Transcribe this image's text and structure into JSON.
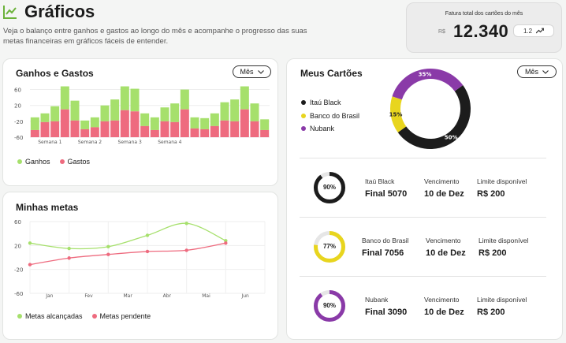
{
  "page": {
    "title": "Gráficos",
    "description": "Veja o balanço entre ganhos e gastos ao longo do mês e acompanhe o progresso das suas metas financeiras em gráficos fáceis de entender."
  },
  "fatura": {
    "label": "Fatura total dos cartões do mês",
    "currency": "R$",
    "value": "12.340",
    "trend": "1.2",
    "trend_icon": "trend-up-icon"
  },
  "ganhos_gastos": {
    "title": "Ganhos e Gastos",
    "filter": "Mês",
    "legend": [
      "Ganhos",
      "Gastos"
    ]
  },
  "metas": {
    "title": "Minhas metas",
    "legend": [
      "Metas alcançadas",
      "Metas pendente"
    ]
  },
  "cartoes": {
    "title": "Meus Cartões",
    "filter": "Mês",
    "legend": [
      "Itaú Black",
      "Banco do Brasil",
      "Nubank"
    ],
    "cards": [
      {
        "pct_label": "90%",
        "pct": 90,
        "color": "#1c1c1c",
        "name": "Itaú Black",
        "final": "Final 5070",
        "venc_label": "Vencimento",
        "venc": "10 de Dez",
        "limite_label": "Limite disponível",
        "limite": "R$ 200"
      },
      {
        "pct_label": "77%",
        "pct": 77,
        "color": "#e8d51e",
        "name": "Banco do Brasil",
        "final": "Final 7056",
        "venc_label": "Vencimento",
        "venc": "10 de Dez",
        "limite_label": "Limite disponível",
        "limite": "R$ 200"
      },
      {
        "pct_label": "90%",
        "pct": 90,
        "color": "#8a3aa8",
        "name": "Nubank",
        "final": "Final 3090",
        "venc_label": "Vencimento",
        "venc": "10 de Dez",
        "limite_label": "Limite disponível",
        "limite": "R$ 200"
      }
    ]
  },
  "colors": {
    "accent_green": "#a6e06c",
    "accent_red": "#ee6b7f",
    "donut_black": "#1c1c1c",
    "donut_yellow": "#e8d51e",
    "donut_purple": "#8a3aa8"
  },
  "chart_data": [
    {
      "type": "bar",
      "title": "Ganhos e Gastos",
      "categories": [
        "Semana 1",
        "Semana 2",
        "Semana 3",
        "Semana 4"
      ],
      "bars_per_category": 4,
      "yticks": [
        "60",
        "20",
        "-20",
        "-60"
      ],
      "ylim": [
        -60,
        75
      ],
      "series": [
        {
          "name": "Ganhos",
          "values": [
            -10,
            0,
            18,
            68,
            32,
            -18,
            -10,
            20,
            35,
            68,
            62,
            0,
            -10,
            15,
            25,
            60,
            -10,
            -12,
            0,
            28,
            35,
            68,
            25,
            -15
          ]
        },
        {
          "name": "Gastos",
          "values": [
            -42,
            -22,
            -20,
            10,
            -18,
            -40,
            -35,
            -20,
            -18,
            8,
            5,
            -32,
            -42,
            -20,
            -22,
            10,
            -38,
            -40,
            -32,
            -18,
            -20,
            10,
            -20,
            -42
          ]
        }
      ]
    },
    {
      "type": "line",
      "title": "Minhas metas",
      "categories": [
        "Jan",
        "Fev",
        "Mar",
        "Abr",
        "Mai",
        "Jun"
      ],
      "yticks": [
        "60",
        "20",
        "-20",
        "-60"
      ],
      "ylim": [
        -60,
        60
      ],
      "series": [
        {
          "name": "Metas alcançadas",
          "x": [
            -0.5,
            0.5,
            1.5,
            2.5,
            3.5,
            4.5
          ],
          "values": [
            24,
            15,
            18,
            37,
            57,
            28
          ]
        },
        {
          "name": "Metas pendente",
          "x": [
            -0.5,
            0.5,
            1.5,
            2.5,
            3.5,
            4.5
          ],
          "values": [
            -12,
            -1,
            5,
            10,
            12,
            24
          ]
        }
      ]
    },
    {
      "type": "pie",
      "title": "Meus Cartões",
      "labels": [
        "Itaú Black",
        "Banco do Brasil",
        "Nubank"
      ],
      "values": [
        50,
        15,
        35
      ],
      "value_labels": [
        "50%",
        "15%",
        "35%"
      ]
    }
  ]
}
